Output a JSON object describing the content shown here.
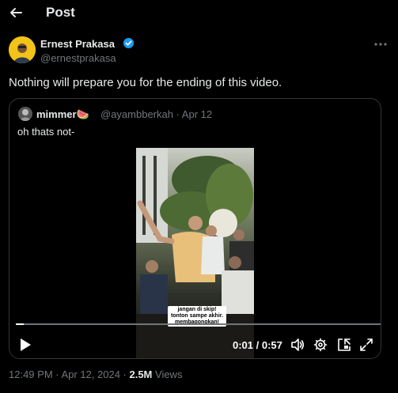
{
  "header": {
    "title": "Post"
  },
  "author": {
    "name": "Ernest Prakasa",
    "handle": "@ernestprakasa"
  },
  "tweet": {
    "text": "Nothing will prepare you for the ending of this video."
  },
  "quote": {
    "name": "mimmer🍉",
    "meta": "@ayambberkah · Apr 12",
    "text": "oh thats not-"
  },
  "video": {
    "caption": "jangan di skip! tonton sampe akhir. membagongkan!",
    "time": "0:01 / 0:57",
    "progress": 0.02
  },
  "footer": {
    "time": "12:49 PM · Apr 12, 2024 · ",
    "views_count": "2.5M",
    "views_label": " Views"
  },
  "colors": {
    "accent": "#1d9bf0",
    "muted": "#71767b",
    "text": "#e7e9ea"
  }
}
